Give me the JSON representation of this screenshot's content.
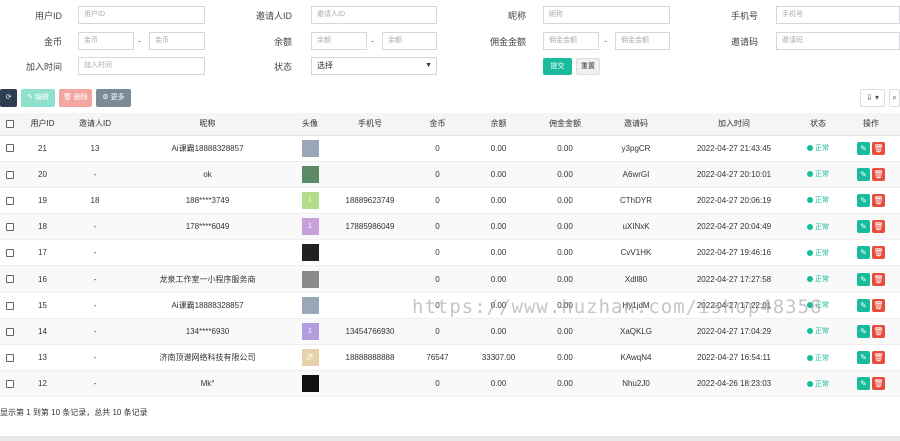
{
  "filters": {
    "user_id": {
      "label": "用户ID",
      "placeholder": "用户ID"
    },
    "inviter_id": {
      "label": "邀请人ID",
      "placeholder": "邀请人ID"
    },
    "nickname": {
      "label": "昵称",
      "placeholder": "昵称"
    },
    "mobile": {
      "label": "手机号",
      "placeholder": "手机号"
    },
    "coins": {
      "label": "金币",
      "placeholder_min": "金币",
      "placeholder_max": "金币"
    },
    "balance": {
      "label": "余额",
      "placeholder_min": "余额",
      "placeholder_max": "余额"
    },
    "commission": {
      "label": "佣金金额",
      "placeholder_min": "佣金金额",
      "placeholder_max": "佣金金额"
    },
    "invite_code": {
      "label": "邀请码",
      "placeholder": "邀请码"
    },
    "join_time": {
      "label": "加入时间",
      "placeholder": "加入时间"
    },
    "status": {
      "label": "状态",
      "value": "选择"
    },
    "dash": "-",
    "submit_label": "提交",
    "reset_label": "重置"
  },
  "toolbar": {
    "refresh_icon": "refresh-icon",
    "edit_label": "✎ 编辑",
    "delete_label": "🗑 删除",
    "more_label": "⚙ 更多",
    "export_label": "⇩ ▾",
    "search_icon": "search-icon"
  },
  "table": {
    "headers": [
      "用户ID",
      "邀请人ID",
      "昵称",
      "头像",
      "手机号",
      "金币",
      "余额",
      "佣金金额",
      "邀请码",
      "加入时间",
      "状态",
      "操作"
    ],
    "rows": [
      {
        "id": "21",
        "inviter": "13",
        "nickname": "Ai课霸18888328857",
        "avatar_color": "#9aa7b8",
        "avatar_text": "",
        "mobile": "",
        "coins": "0",
        "balance": "0.00",
        "commission": "0.00",
        "code": "y3pgCR",
        "time": "2022-04-27 21:43:45",
        "status": "正常"
      },
      {
        "id": "20",
        "inviter": "-",
        "nickname": "ok",
        "avatar_color": "#5b8a66",
        "avatar_text": "",
        "mobile": "",
        "coins": "0",
        "balance": "0.00",
        "commission": "0.00",
        "code": "A6wrGI",
        "time": "2022-04-27 20:10:01",
        "status": "正常"
      },
      {
        "id": "19",
        "inviter": "18",
        "nickname": "188****3749",
        "avatar_color": "#b4dc8c",
        "avatar_text": "1",
        "mobile": "18889623749",
        "coins": "0",
        "balance": "0.00",
        "commission": "0.00",
        "code": "CThDYR",
        "time": "2022-04-27 20:06:19",
        "status": "正常"
      },
      {
        "id": "18",
        "inviter": "-",
        "nickname": "178****6049",
        "avatar_color": "#c8a0dc",
        "avatar_text": "1",
        "mobile": "17885986049",
        "coins": "0",
        "balance": "0.00",
        "commission": "0.00",
        "code": "uXINxK",
        "time": "2022-04-27 20:04:49",
        "status": "正常"
      },
      {
        "id": "17",
        "inviter": "-",
        "nickname": "",
        "avatar_color": "#222222",
        "avatar_text": "",
        "mobile": "",
        "coins": "0",
        "balance": "0.00",
        "commission": "0.00",
        "code": "CvV1HK",
        "time": "2022-04-27 19:46:16",
        "status": "正常"
      },
      {
        "id": "16",
        "inviter": "-",
        "nickname": "龙泉工作室一小程序服务商",
        "avatar_color": "#8a8a8a",
        "avatar_text": "",
        "mobile": "",
        "coins": "0",
        "balance": "0.00",
        "commission": "0.00",
        "code": "Xdll80",
        "time": "2022-04-27 17:27:58",
        "status": "正常"
      },
      {
        "id": "15",
        "inviter": "-",
        "nickname": "Ai课霸18888328857",
        "avatar_color": "#9aa7b8",
        "avatar_text": "",
        "mobile": "",
        "coins": "0",
        "balance": "0.00",
        "commission": "0.00",
        "code": "Hy1jdM",
        "time": "2022-04-27 17:22:01",
        "status": "正常"
      },
      {
        "id": "14",
        "inviter": "-",
        "nickname": "134****6930",
        "avatar_color": "#b49ce0",
        "avatar_text": "1",
        "mobile": "13454766930",
        "coins": "0",
        "balance": "0.00",
        "commission": "0.00",
        "code": "XaQKLG",
        "time": "2022-04-27 17:04:29",
        "status": "正常"
      },
      {
        "id": "13",
        "inviter": "-",
        "nickname": "济南顶谱网络科技有限公司",
        "avatar_color": "#e6d2a8",
        "avatar_text": "济",
        "mobile": "18888888888",
        "coins": "76547",
        "balance": "33307.00",
        "commission": "0.00",
        "code": "KAwqN4",
        "time": "2022-04-27 16:54:11",
        "status": "正常"
      },
      {
        "id": "12",
        "inviter": "-",
        "nickname": "Mk°",
        "avatar_color": "#111111",
        "avatar_text": "",
        "mobile": "",
        "coins": "0",
        "balance": "0.00",
        "commission": "0.00",
        "code": "Nhu2J0",
        "time": "2022-04-26 18:23:03",
        "status": "正常"
      }
    ]
  },
  "footer": {
    "text": "显示第 1 到第 10 条记录，总共 10 条记录"
  },
  "watermark": {
    "text": "https://www.huzhan.com/ishop48356"
  },
  "colors": {
    "accent": "#18bc9c",
    "danger": "#e74c3c",
    "dark": "#2c3e50"
  }
}
